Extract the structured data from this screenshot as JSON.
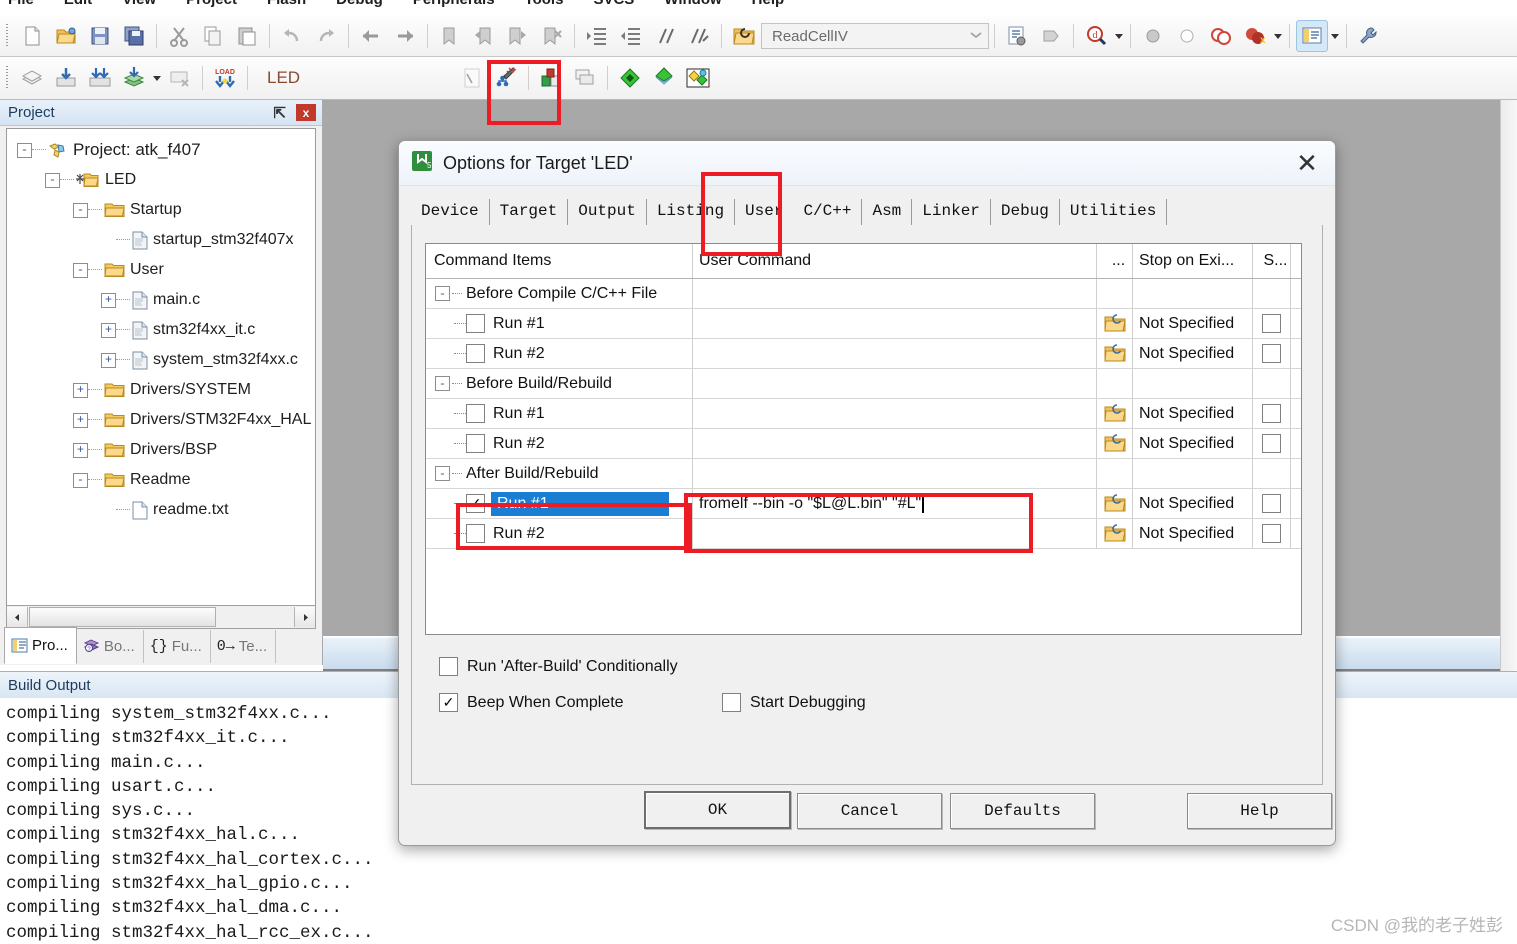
{
  "menubar": {
    "items": [
      "File",
      "Edit",
      "View",
      "Project",
      "Flash",
      "Debug",
      "Peripherals",
      "Tools",
      "SVCS",
      "Window",
      "Help"
    ]
  },
  "toolbar1": {
    "icons": [
      "new-file-icon",
      "open-file-icon",
      "save-icon",
      "save-all-icon",
      "cut-icon",
      "copy-icon",
      "paste-icon",
      "undo-icon",
      "redo-icon",
      "navigate-back-icon",
      "navigate-forward-icon",
      "bookmark-toggle-icon",
      "bookmark-prev-icon",
      "bookmark-next-icon",
      "bookmark-clear-icon",
      "indent-icon",
      "outdent-icon",
      "comment-icon",
      "uncomment-icon"
    ],
    "project_icon": "open-project-icon",
    "right_icons": [
      "configuration-wizard-icon",
      "show-disassembly-icon",
      "find-in-files-icon",
      "insert-breakpoint-icon",
      "disable-breakpoint-icon",
      "disable-all-breakpoints-icon",
      "kill-all-breakpoints-icon",
      "manage-windows-icon",
      "configure-tools-icon"
    ]
  },
  "toolbar2": {
    "icons": [
      "translate-icon",
      "build-icon",
      "rebuild-icon",
      "batch-build-icon",
      "stop-build-icon",
      "download-icon"
    ],
    "target_label": "LED",
    "right_icons": [
      "start-debug-session-icon",
      "options-for-target-icon",
      "manage-project-items-icon",
      "multi-project-icon",
      "packs-icon",
      "pack-installer-icon",
      "manage-run-time-icon"
    ]
  },
  "project_combo": {
    "value": "ReadCellIV",
    "icon": "open-project-folder-icon",
    "dropdown_icon": "chevron-down-icon"
  },
  "project_panel": {
    "title": "Project",
    "pin_icon": "pin-icon",
    "close_icon": "close-icon",
    "tree": [
      {
        "label": "Project: atk_f407",
        "depth": 0,
        "toggle": "-",
        "icon": "project-icon"
      },
      {
        "label": "LED",
        "depth": 1,
        "toggle": "-",
        "icon": "target-folder-icon"
      },
      {
        "label": "Startup",
        "depth": 2,
        "toggle": "-",
        "icon": "group-folder-icon"
      },
      {
        "label": "startup_stm32f407x",
        "depth": 3,
        "toggle": "",
        "icon": "asm-file-icon"
      },
      {
        "label": "User",
        "depth": 2,
        "toggle": "-",
        "icon": "group-folder-icon"
      },
      {
        "label": "main.c",
        "depth": 3,
        "toggle": "+",
        "icon": "c-file-icon"
      },
      {
        "label": "stm32f4xx_it.c",
        "depth": 3,
        "toggle": "+",
        "icon": "c-file-icon"
      },
      {
        "label": "system_stm32f4xx.c",
        "depth": 3,
        "toggle": "+",
        "icon": "c-file-icon"
      },
      {
        "label": "Drivers/SYSTEM",
        "depth": 2,
        "toggle": "+",
        "icon": "group-folder-icon"
      },
      {
        "label": "Drivers/STM32F4xx_HAL",
        "depth": 2,
        "toggle": "+",
        "icon": "group-folder-icon"
      },
      {
        "label": "Drivers/BSP",
        "depth": 2,
        "toggle": "+",
        "icon": "group-folder-icon"
      },
      {
        "label": "Readme",
        "depth": 2,
        "toggle": "-",
        "icon": "group-folder-icon"
      },
      {
        "label": "readme.txt",
        "depth": 3,
        "toggle": "",
        "icon": "txt-file-icon"
      }
    ],
    "scroll": {
      "left_arrow": "◀",
      "right_arrow": "▶"
    },
    "tabs": [
      {
        "label": "Pro...",
        "icon": "project-tab-icon",
        "selected": true
      },
      {
        "label": "Bo...",
        "icon": "books-tab-icon",
        "selected": false
      },
      {
        "label": "Fu...",
        "icon": "functions-tab-icon",
        "selected": false
      },
      {
        "label": "Te...",
        "icon": "templates-tab-icon",
        "selected": false
      }
    ]
  },
  "build_output": {
    "title": "Build Output",
    "lines": [
      "compiling system_stm32f4xx.c...",
      "compiling stm32f4xx_it.c...",
      "compiling main.c...",
      "compiling usart.c...",
      "compiling sys.c...",
      "compiling stm32f4xx_hal.c...",
      "compiling stm32f4xx_hal_cortex.c...",
      "compiling stm32f4xx_hal_gpio.c...",
      "compiling stm32f4xx_hal_dma.c...",
      "compiling stm32f4xx_hal_rcc_ex.c..."
    ]
  },
  "watermark": "CSDN @我的老子姓彭",
  "dialog": {
    "title": "Options for Target 'LED'",
    "app_icon": "keil-uvision-icon",
    "close_icon": "close-icon",
    "tabs": [
      {
        "label": "Device",
        "selected": false
      },
      {
        "label": "Target",
        "selected": false
      },
      {
        "label": "Output",
        "selected": false
      },
      {
        "label": "Listing",
        "selected": false
      },
      {
        "label": "User",
        "selected": true
      },
      {
        "label": "C/C++",
        "selected": false
      },
      {
        "label": "Asm",
        "selected": false
      },
      {
        "label": "Linker",
        "selected": false
      },
      {
        "label": "Debug",
        "selected": false
      },
      {
        "label": "Utilities",
        "selected": false
      }
    ],
    "table": {
      "headers": [
        "Command Items",
        "User Command",
        "...",
        "Stop on Exi...",
        "S..."
      ],
      "folder_icon": "browse-folder-icon",
      "rows": [
        {
          "kind": "group",
          "label": "Before Compile C/C++ File",
          "toggle": "-"
        },
        {
          "kind": "run",
          "label": "Run #1",
          "checked": false,
          "command": "",
          "stop_on_exit": "Not Specified",
          "s_checked": false,
          "selected": false
        },
        {
          "kind": "run",
          "label": "Run #2",
          "checked": false,
          "command": "",
          "stop_on_exit": "Not Specified",
          "s_checked": false,
          "selected": false
        },
        {
          "kind": "group",
          "label": "Before Build/Rebuild",
          "toggle": "-"
        },
        {
          "kind": "run",
          "label": "Run #1",
          "checked": false,
          "command": "",
          "stop_on_exit": "Not Specified",
          "s_checked": false,
          "selected": false
        },
        {
          "kind": "run",
          "label": "Run #2",
          "checked": false,
          "command": "",
          "stop_on_exit": "Not Specified",
          "s_checked": false,
          "selected": false
        },
        {
          "kind": "group",
          "label": "After Build/Rebuild",
          "toggle": "-"
        },
        {
          "kind": "run",
          "label": "Run #1",
          "checked": true,
          "command": "fromelf --bin -o \"$L@L.bin\" \"#L\"",
          "stop_on_exit": "Not Specified",
          "s_checked": false,
          "selected": true
        },
        {
          "kind": "run",
          "label": "Run #2",
          "checked": false,
          "command": "",
          "stop_on_exit": "Not Specified",
          "s_checked": false,
          "selected": false
        }
      ]
    },
    "options": {
      "run_after_build_conditionally": {
        "label": "Run 'After-Build' Conditionally",
        "checked": false
      },
      "beep_when_complete": {
        "label": "Beep When Complete",
        "checked": true
      },
      "start_debugging": {
        "label": "Start Debugging",
        "checked": false
      }
    },
    "buttons": {
      "ok": "OK",
      "cancel": "Cancel",
      "defaults": "Defaults",
      "help": "Help"
    }
  },
  "colors": {
    "annotation_red": "#ed1c24",
    "selection_blue": "#1a7fd4",
    "panel_title_blue": "#1b3a5c",
    "target_label_brown": "#8a4a32"
  }
}
